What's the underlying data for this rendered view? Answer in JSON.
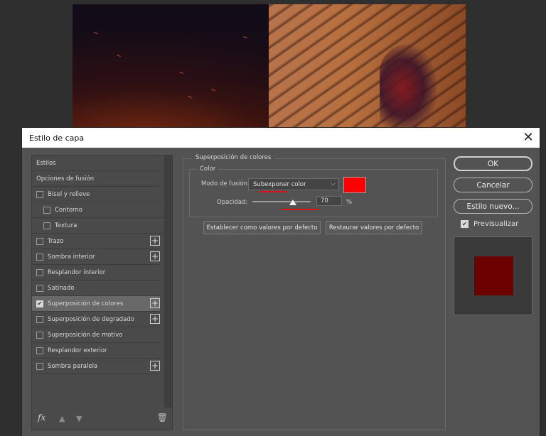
{
  "dialog": {
    "title": "Estilo de capa"
  },
  "styles_list": {
    "items": [
      {
        "label": "Estilos",
        "checkbox": false,
        "checked": false,
        "plus": false,
        "indent": false,
        "selected": false
      },
      {
        "label": "Opciones de fusión",
        "checkbox": false,
        "checked": false,
        "plus": false,
        "indent": false,
        "selected": false
      },
      {
        "label": "Bisel y relieve",
        "checkbox": true,
        "checked": false,
        "plus": false,
        "indent": false,
        "selected": false
      },
      {
        "label": "Contorno",
        "checkbox": true,
        "checked": false,
        "plus": false,
        "indent": true,
        "selected": false
      },
      {
        "label": "Textura",
        "checkbox": true,
        "checked": false,
        "plus": false,
        "indent": true,
        "selected": false
      },
      {
        "label": "Trazo",
        "checkbox": true,
        "checked": false,
        "plus": true,
        "indent": false,
        "selected": false
      },
      {
        "label": "Sombra interior",
        "checkbox": true,
        "checked": false,
        "plus": true,
        "indent": false,
        "selected": false
      },
      {
        "label": "Resplandor interior",
        "checkbox": true,
        "checked": false,
        "plus": false,
        "indent": false,
        "selected": false
      },
      {
        "label": "Satinado",
        "checkbox": true,
        "checked": false,
        "plus": false,
        "indent": false,
        "selected": false
      },
      {
        "label": "Superposición de colores",
        "checkbox": true,
        "checked": true,
        "plus": true,
        "indent": false,
        "selected": true
      },
      {
        "label": "Superposición de degradado",
        "checkbox": true,
        "checked": false,
        "plus": true,
        "indent": false,
        "selected": false
      },
      {
        "label": "Superposición de motivo",
        "checkbox": true,
        "checked": false,
        "plus": false,
        "indent": false,
        "selected": false
      },
      {
        "label": "Resplandor exterior",
        "checkbox": true,
        "checked": false,
        "plus": false,
        "indent": false,
        "selected": false
      },
      {
        "label": "Sombra paralela",
        "checkbox": true,
        "checked": false,
        "plus": true,
        "indent": false,
        "selected": false
      }
    ],
    "bottom": {
      "fx_label": "fx",
      "fx_icon": "fx-menu-icon",
      "up_icon": "move-up-icon",
      "down_icon": "move-down-icon",
      "trash_icon": "trash-icon"
    }
  },
  "settings": {
    "group_title": "Superposición de colores",
    "subgroup_title": "Color",
    "blend_mode_label": "Modo de fusión:",
    "blend_mode_value": "Subexponer color",
    "color_swatch": "#ff0000",
    "opacity_label": "Opacidad:",
    "opacity_value": "70",
    "opacity_unit": "%",
    "opacity_level": 0.7,
    "default_button": "Establecer como valores por defecto",
    "reset_button": "Restaurar valores por defecto"
  },
  "actions": {
    "ok": "OK",
    "cancel": "Cancelar",
    "new_style": "Estilo nuevo...",
    "preview_label": "Previsualizar",
    "preview_checked": true,
    "preview_color": "#6d0000"
  },
  "colors": {
    "annotation_underline": "#dd1111",
    "dialog_bg": "#535353"
  }
}
